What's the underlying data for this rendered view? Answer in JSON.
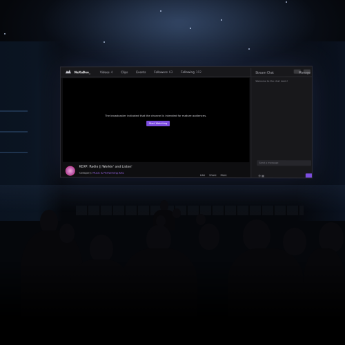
{
  "colors": {
    "accent": "#7d4ee0",
    "topbar": "#18181b",
    "player_bg": "#000000",
    "room": "#05060a"
  },
  "header": {
    "logo_icon": "channel-logo-icon",
    "channel_name": "NeXaBeo_",
    "nav": [
      {
        "label": "Videos",
        "count": "4"
      },
      {
        "label": "Clips",
        "count": ""
      },
      {
        "label": "Events",
        "count": ""
      },
      {
        "label": "Followers",
        "count": "63"
      },
      {
        "label": "Following",
        "count": "102"
      }
    ],
    "chat_title": "Stream Chat",
    "chat_right": "Manage"
  },
  "player": {
    "mature_notice": "The broadcaster indicated that the channel is intended for mature audiences.",
    "watch_button": "Start Watching"
  },
  "chat": {
    "welcome": "Welcome to the chat room!",
    "input_placeholder": "Send a message"
  },
  "stream": {
    "title": "KEXP: Radio || Workin' and Listen'",
    "category_prefix": "Category:",
    "category": "Music & Performing Arts",
    "actions": [
      "Like",
      "Share",
      "More"
    ]
  }
}
